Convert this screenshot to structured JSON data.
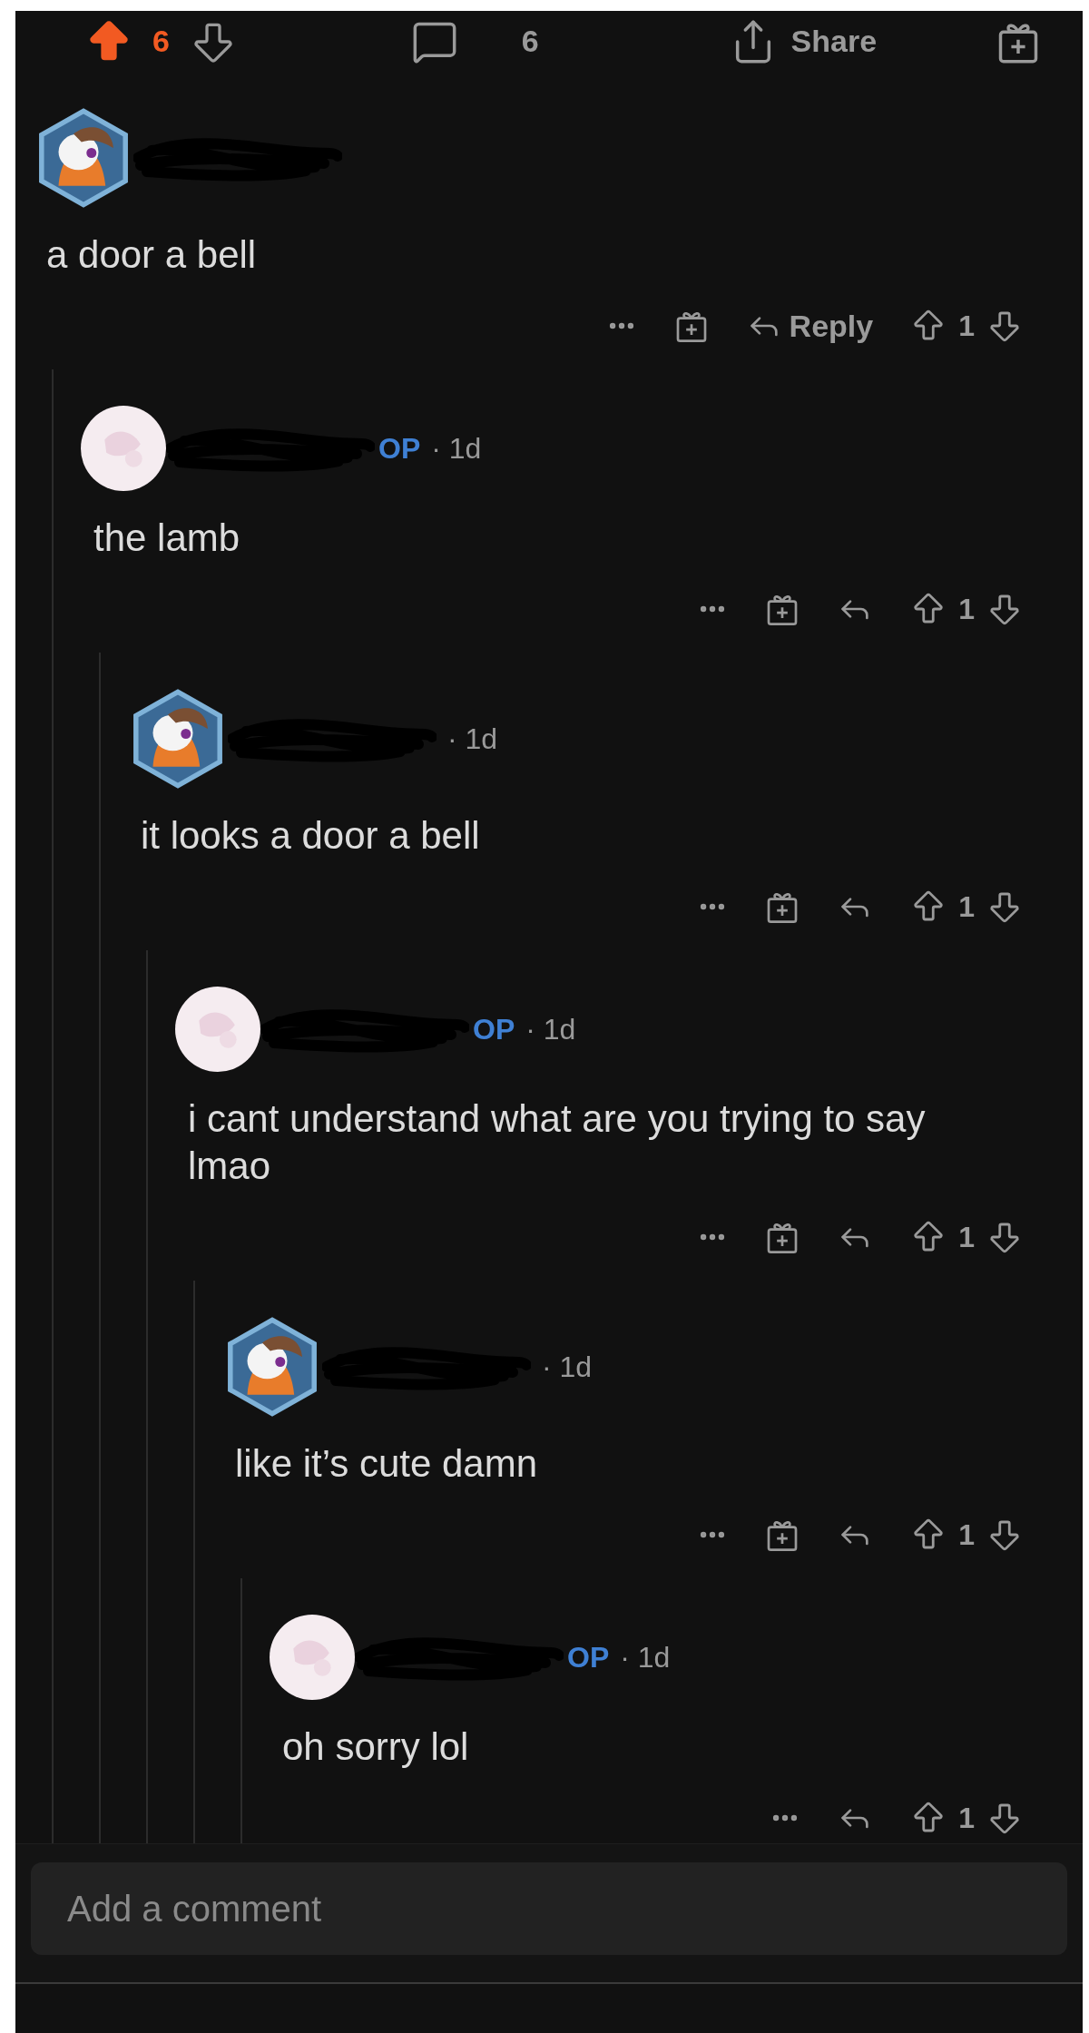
{
  "post_bar": {
    "upvoted": true,
    "score": "6",
    "comment_count": "6",
    "share_label": "Share"
  },
  "comments": [
    {
      "kind": "hexagon",
      "body": "a door a bell",
      "gift": true,
      "reply_label": "Reply",
      "votes": "1",
      "children": [
        {
          "kind": "circle",
          "badge": "OP",
          "time": "· 1d",
          "body": "the lamb",
          "gift": true,
          "votes": "1",
          "children": [
            {
              "kind": "hexagon",
              "time": "· 1d",
              "body": "it looks a door a bell",
              "gift": true,
              "votes": "1",
              "children": [
                {
                  "kind": "circle",
                  "badge": "OP",
                  "time": "· 1d",
                  "body": "i cant understand what are you trying to say lmao",
                  "gift": true,
                  "votes": "1",
                  "children": [
                    {
                      "kind": "hexagon",
                      "time": "· 1d",
                      "body": "like it’s cute damn",
                      "gift": true,
                      "votes": "1",
                      "children": [
                        {
                          "kind": "circle",
                          "badge": "OP",
                          "time": "· 1d",
                          "body": "oh sorry lol",
                          "gift": false,
                          "votes": "1"
                        }
                      ]
                    }
                  ]
                }
              ]
            }
          ]
        }
      ]
    }
  ],
  "comment_box": {
    "placeholder": "Add a comment"
  }
}
